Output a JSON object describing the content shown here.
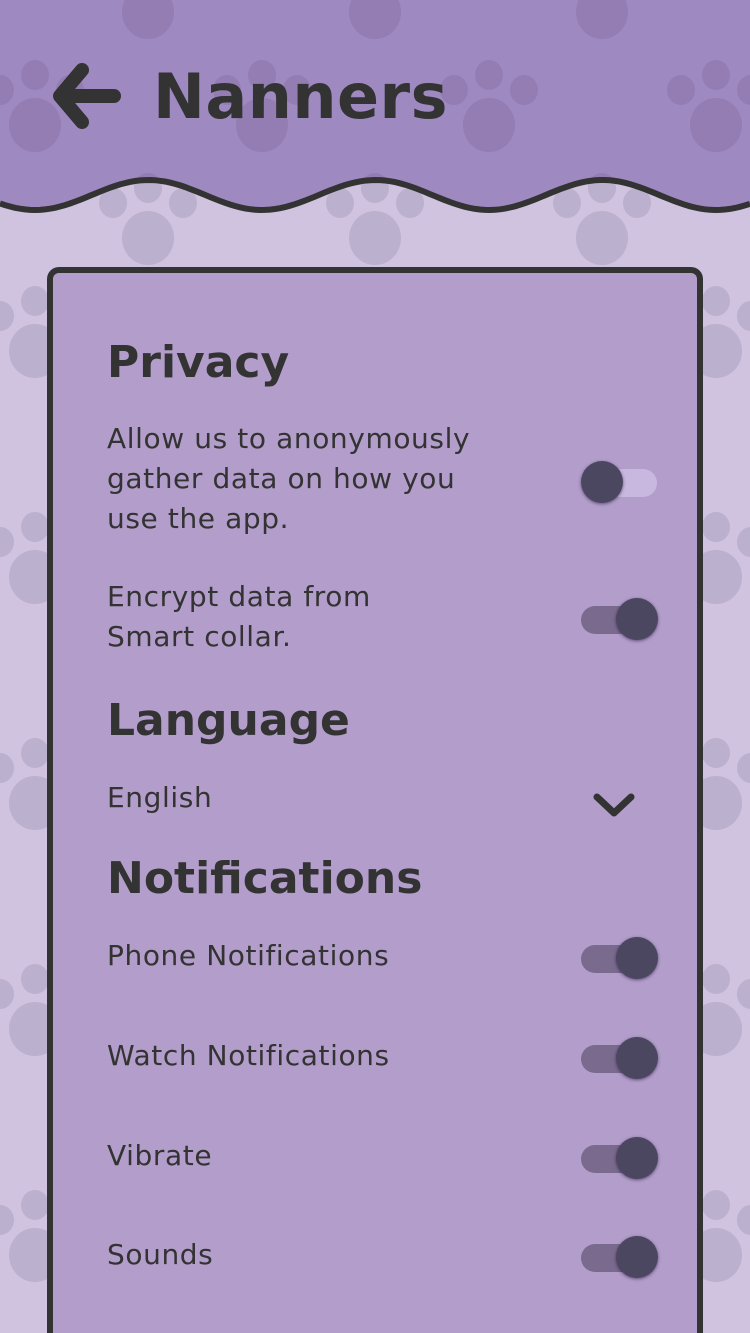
{
  "colors": {
    "header": "#9f89c1",
    "background": "#d0c3e0",
    "card": "#b39dcb",
    "text": "#333333",
    "knob": "#4b4760",
    "track_on": "#7a6a8e",
    "track_off": "#c8b8df"
  },
  "header": {
    "title": "Nanners",
    "back_icon": "arrow-left-icon"
  },
  "privacy": {
    "heading": "Privacy",
    "items": [
      {
        "label": "Allow us to anonymously gather data on how you use the app.",
        "enabled": false
      },
      {
        "label": "Encrypt data from Smart collar.",
        "enabled": true
      }
    ]
  },
  "language": {
    "heading": "Language",
    "selected": "English",
    "icon": "chevron-down-icon"
  },
  "notifications": {
    "heading": "Notifications",
    "items": [
      {
        "label": "Phone Notifications",
        "enabled": true
      },
      {
        "label": "Watch Notifications",
        "enabled": true
      },
      {
        "label": "Vibrate",
        "enabled": true
      },
      {
        "label": "Sounds",
        "enabled": true
      }
    ]
  }
}
